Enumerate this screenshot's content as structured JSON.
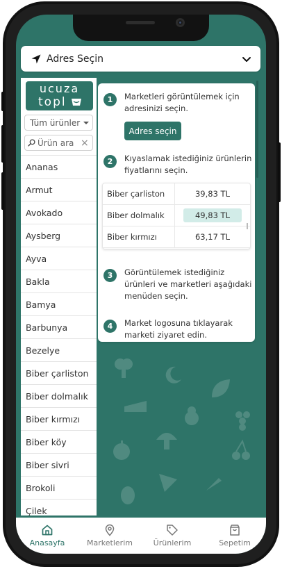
{
  "header": {
    "address_label": "Adres Seçin",
    "location_icon": "navigation-arrow-icon",
    "chevron_icon": "chevron-down-icon"
  },
  "sidebar": {
    "logo_line1": "ucuza",
    "logo_line2": "topl",
    "filter_label": "Tüm ürünler",
    "search_placeholder": "Ürün ara",
    "clear_symbol": "×",
    "items": [
      {
        "label": "Ananas"
      },
      {
        "label": "Armut"
      },
      {
        "label": "Avokado"
      },
      {
        "label": "Aysberg"
      },
      {
        "label": "Ayva"
      },
      {
        "label": "Bakla"
      },
      {
        "label": "Bamya"
      },
      {
        "label": "Barbunya"
      },
      {
        "label": "Bezelye"
      },
      {
        "label": "Biber çarliston"
      },
      {
        "label": "Biber dolmalık"
      },
      {
        "label": "Biber kırmızı"
      },
      {
        "label": "Biber köy"
      },
      {
        "label": "Biber sivri"
      },
      {
        "label": "Brokoli"
      },
      {
        "label": "Çilek"
      }
    ]
  },
  "info": {
    "steps": [
      {
        "num": "1",
        "text": "Marketleri görüntülemek için adresinizi seçin."
      },
      {
        "num": "2",
        "text": "Kıyaslamak istediğiniz ürünlerin fiyatlarını seçin."
      },
      {
        "num": "3",
        "text": "Görüntülemek istediğiniz ürünleri ve marketleri aşağıdaki menüden seçin."
      },
      {
        "num": "4",
        "text": "Market logosuna tıklayarak marketi ziyaret edin."
      }
    ],
    "address_button": "Adres seçin",
    "prices": [
      {
        "name": "Biber çarliston",
        "price": "39,83 TL",
        "highlighted": false
      },
      {
        "name": "Biber dolmalık",
        "price": "49,83 TL",
        "highlighted": true
      },
      {
        "name": "Biber kırmızı",
        "price": "63,17 TL",
        "highlighted": false
      }
    ]
  },
  "tabs": [
    {
      "label": "Anasayfa",
      "icon": "home-icon",
      "active": true
    },
    {
      "label": "Marketlerim",
      "icon": "map-pin-icon",
      "active": false
    },
    {
      "label": "Ürünlerim",
      "icon": "tag-icon",
      "active": false
    },
    {
      "label": "Sepetim",
      "icon": "shopping-bag-icon",
      "active": false
    }
  ],
  "colors": {
    "brand": "#2e7468",
    "highlight": "#d2ece8",
    "active_tab": "#2e7468",
    "inactive_tab": "#777777"
  }
}
